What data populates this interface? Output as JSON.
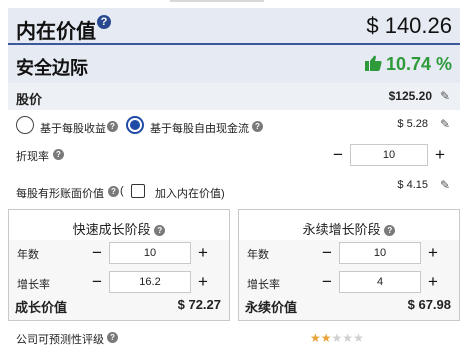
{
  "intrinsic_value": {
    "label": "内在价值",
    "value": "$ 140.26"
  },
  "margin_of_safety": {
    "label": "安全边际",
    "value": "10.74 %"
  },
  "share_price": {
    "label": "股价",
    "value": "$125.20"
  },
  "options": {
    "eps": {
      "label": "基于每股收益",
      "value": "",
      "selected": false
    },
    "fcf": {
      "label": "基于每股自由现金流",
      "value": "$ 5.28",
      "selected": true
    }
  },
  "discount_rate": {
    "label": "折现率",
    "value": "10"
  },
  "tangible_book": {
    "label": "每股有形账面价值",
    "paren_open": "(",
    "checkbox_label": "加入内在价值)",
    "value": "$ 4.15"
  },
  "growth_stage": {
    "title": "快速成长阶段",
    "years_label": "年数",
    "years_value": "10",
    "rate_label": "增长率",
    "rate_value": "16.2",
    "result_label": "成长价值",
    "result_value": "$ 72.27"
  },
  "terminal_stage": {
    "title": "永续增长阶段",
    "years_label": "年数",
    "years_value": "10",
    "rate_label": "增长率",
    "rate_value": "4",
    "result_label": "永续价值",
    "result_value": "$ 67.98"
  },
  "predictability": {
    "label": "公司可预测性评级",
    "stars_filled": 2,
    "stars_total": 5
  },
  "colors": {
    "accent": "#1f4aa6",
    "positive": "#2e9a3a",
    "header_bg": "#e6ebf3",
    "star": "#e8a33a"
  }
}
